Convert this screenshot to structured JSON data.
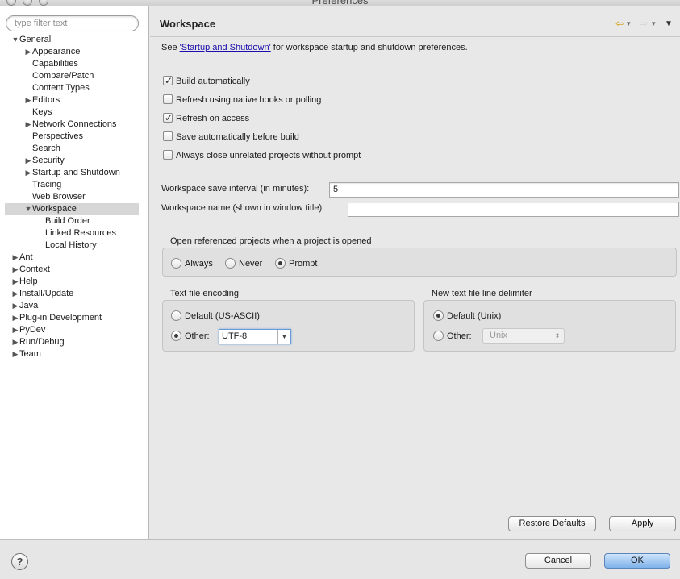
{
  "window": {
    "title": "Preferences"
  },
  "sidebar": {
    "filter_placeholder": "type filter text",
    "tree": [
      {
        "label": "General",
        "twisty": "▼"
      },
      {
        "label": "Appearance",
        "twisty": "▶"
      },
      {
        "label": "Capabilities",
        "twisty": ""
      },
      {
        "label": "Compare/Patch",
        "twisty": ""
      },
      {
        "label": "Content Types",
        "twisty": ""
      },
      {
        "label": "Editors",
        "twisty": "▶"
      },
      {
        "label": "Keys",
        "twisty": ""
      },
      {
        "label": "Network Connections",
        "twisty": "▶"
      },
      {
        "label": "Perspectives",
        "twisty": ""
      },
      {
        "label": "Search",
        "twisty": ""
      },
      {
        "label": "Security",
        "twisty": "▶"
      },
      {
        "label": "Startup and Shutdown",
        "twisty": "▶"
      },
      {
        "label": "Tracing",
        "twisty": ""
      },
      {
        "label": "Web Browser",
        "twisty": ""
      },
      {
        "label": "Workspace",
        "twisty": "▼"
      },
      {
        "label": "Build Order",
        "twisty": ""
      },
      {
        "label": "Linked Resources",
        "twisty": ""
      },
      {
        "label": "Local History",
        "twisty": ""
      },
      {
        "label": "Ant",
        "twisty": "▶"
      },
      {
        "label": "Context",
        "twisty": "▶"
      },
      {
        "label": "Help",
        "twisty": "▶"
      },
      {
        "label": "Install/Update",
        "twisty": "▶"
      },
      {
        "label": "Java",
        "twisty": "▶"
      },
      {
        "label": "Plug-in Development",
        "twisty": "▶"
      },
      {
        "label": "PyDev",
        "twisty": "▶"
      },
      {
        "label": "Run/Debug",
        "twisty": "▶"
      },
      {
        "label": "Team",
        "twisty": "▶"
      }
    ],
    "selected": "Workspace"
  },
  "page": {
    "title": "Workspace",
    "nav_back_icon": "⇦",
    "nav_forward_icon": "⇨",
    "nav_dropdown_icon": "▾",
    "menu_icon": "▼",
    "desc_prefix": "See ",
    "desc_link": "'Startup and Shutdown'",
    "desc_suffix": " for workspace startup and shutdown preferences.",
    "checkboxes": [
      {
        "label": "Build automatically",
        "checked": true
      },
      {
        "label": "Refresh using native hooks or polling",
        "checked": false
      },
      {
        "label": "Refresh on access",
        "checked": true
      },
      {
        "label": "Save automatically before build",
        "checked": false
      },
      {
        "label": "Always close unrelated projects without prompt",
        "checked": false
      }
    ],
    "save_interval_label": "Workspace save interval (in minutes):",
    "save_interval_value": "5",
    "workspace_name_label": "Workspace name (shown in window title):",
    "workspace_name_value": "",
    "open_ref_group": {
      "title": "Open referenced projects when a project is opened",
      "options": [
        "Always",
        "Never",
        "Prompt"
      ],
      "selected": "Prompt"
    },
    "encoding_group": {
      "title": "Text file encoding",
      "default_label": "Default (US-ASCII)",
      "other_label": "Other:",
      "selected": "Other",
      "other_value": "UTF-8"
    },
    "delimiter_group": {
      "title": "New text file line delimiter",
      "default_label": "Default (Unix)",
      "other_label": "Other:",
      "selected": "Default",
      "other_value": "Unix"
    },
    "restore_defaults_label": "Restore Defaults",
    "apply_label": "Apply"
  },
  "footer": {
    "help_icon": "?",
    "cancel_label": "Cancel",
    "ok_label": "OK"
  }
}
